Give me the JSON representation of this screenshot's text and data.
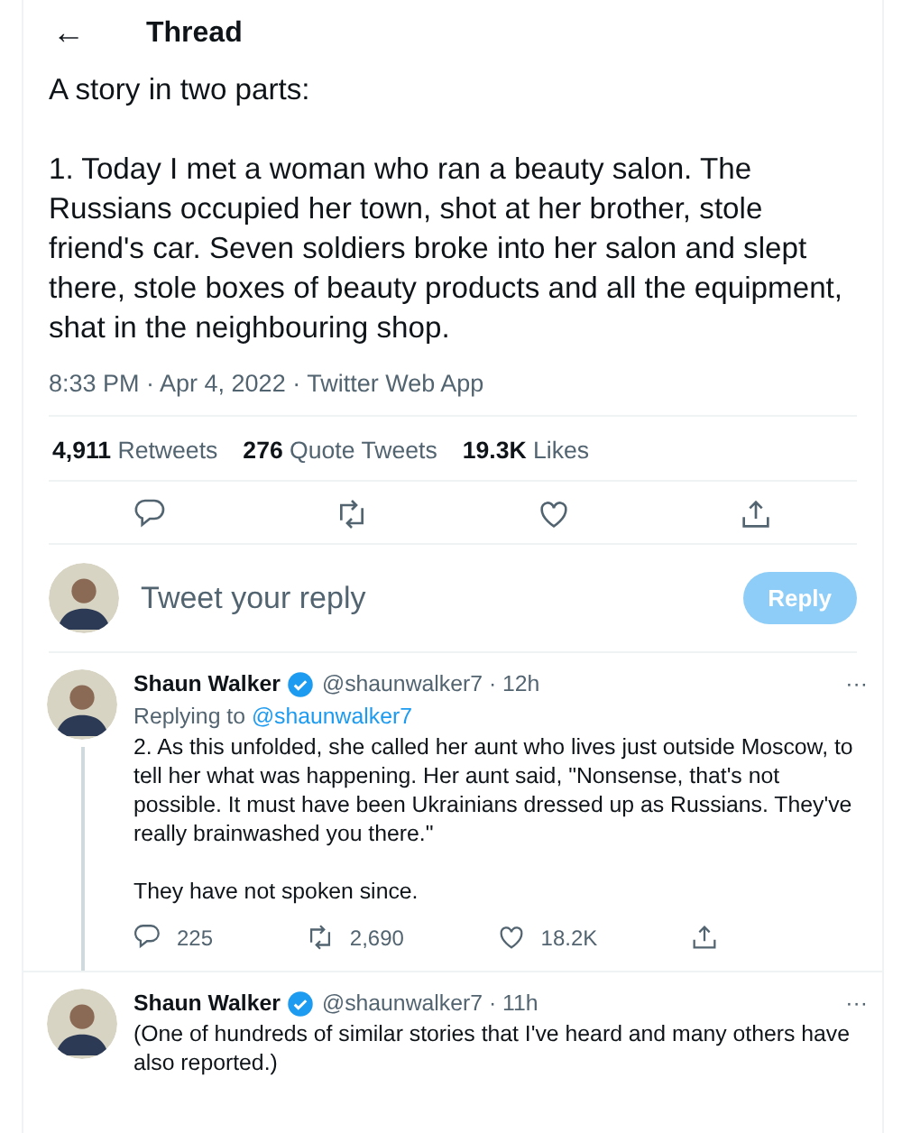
{
  "header": {
    "back": "←",
    "title": "Thread"
  },
  "tweet": {
    "text": "A story in two parts:\n\n1. Today I met a woman who ran a beauty salon. The Russians occupied her town, shot at her brother, stole friend's car. Seven soldiers broke into her salon and slept there, stole boxes of beauty products and all the equipment, shat in the neighbouring shop.",
    "meta": "8:33 PM · Apr 4, 2022 · Twitter Web App"
  },
  "stats": [
    {
      "count": "4,911",
      "label": "Retweets"
    },
    {
      "count": "276",
      "label": "Quote Tweets"
    },
    {
      "count": "19.3K",
      "label": "Likes"
    }
  ],
  "actions": [
    {
      "kind": "reply"
    },
    {
      "kind": "retweet"
    },
    {
      "kind": "like"
    },
    {
      "kind": "share"
    }
  ],
  "composer": {
    "placeholder": "Tweet your reply",
    "button": {
      "label": "Reply",
      "disabled": true
    }
  },
  "replies": [
    {
      "name": "Shaun Walker",
      "verified": true,
      "handle": "@shaunwalker7",
      "separator": "·",
      "time": "12h",
      "more": "···",
      "replying_to": {
        "prefix": "Replying to",
        "handle": "@shaunwalker7"
      },
      "text": "2. As this unfolded, she called her aunt who lives just outside Moscow, to tell her what was happening. Her aunt said, \"Nonsense, that's not possible. It must have been Ukrainians dressed up as Russians. They've really brainwashed you there.\"\n\nThey have not spoken since.",
      "thread_line": true,
      "actions": [
        {
          "kind": "reply",
          "count": "225"
        },
        {
          "kind": "retweet",
          "count": "2,690"
        },
        {
          "kind": "like",
          "count": "18.2K"
        },
        {
          "kind": "share"
        }
      ]
    },
    {
      "name": "Shaun Walker",
      "verified": true,
      "handle": "@shaunwalker7",
      "separator": "·",
      "time": "11h",
      "more": "···",
      "text": "(One of hundreds of similar stories that I've heard and many others have also reported.)",
      "thread_line": false
    }
  ]
}
